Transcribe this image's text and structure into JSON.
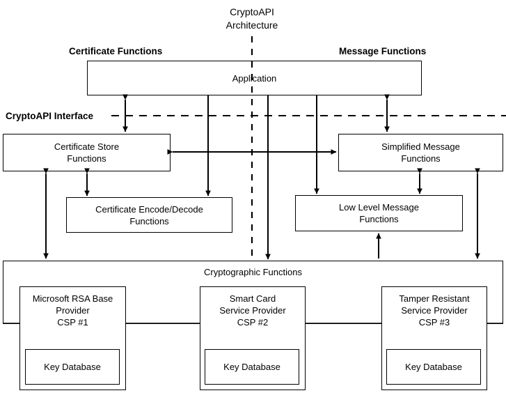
{
  "diagram": {
    "title_line1": "CryptoAPI",
    "title_line2": "Architecture",
    "left_header": "Certificate Functions",
    "right_header": "Message Functions",
    "interface_label": "CryptoAPI Interface",
    "colors": {
      "stroke": "#000000",
      "background": "#ffffff"
    }
  },
  "boxes": {
    "application": "Application",
    "certificate_store_line1": "Certificate Store",
    "certificate_store_line2": "Functions",
    "certificate_encode_line1": "Certificate Encode/Decode",
    "certificate_encode_line2": "Functions",
    "simplified_message_line1": "Simplified Message",
    "simplified_message_line2": "Functions",
    "low_level_message_line1": "Low Level Message",
    "low_level_message_line2": "Functions",
    "cryptographic_functions": "Cryptographic Functions"
  },
  "providers": [
    {
      "line1": "Microsoft RSA Base",
      "line2": "Provider",
      "line3": "CSP #1",
      "key_database": "Key Database"
    },
    {
      "line1": "Smart Card",
      "line2": "Service Provider",
      "line3": "CSP #2",
      "key_database": "Key Database"
    },
    {
      "line1": "Tamper Resistant",
      "line2": "Service Provider",
      "line3": "CSP #3",
      "key_database": "Key Database"
    }
  ]
}
